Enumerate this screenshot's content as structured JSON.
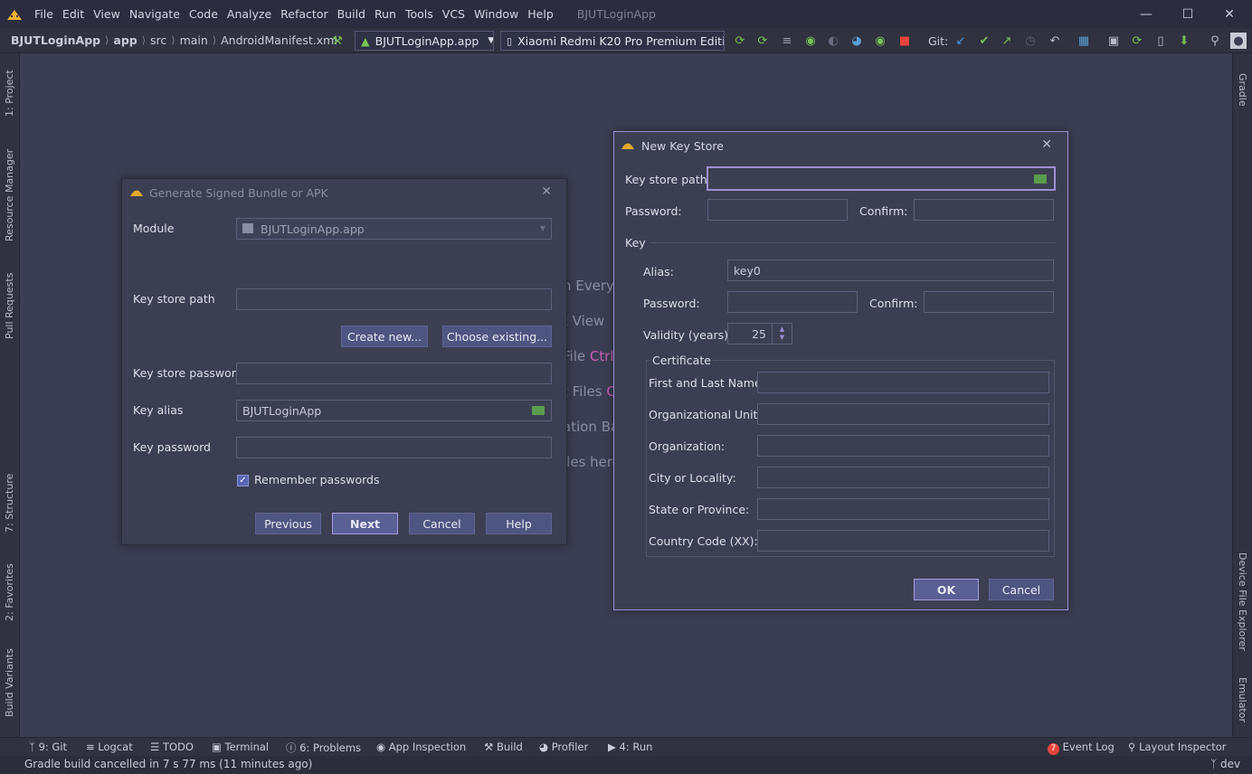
{
  "menubar": {
    "items": [
      "File",
      "Edit",
      "View",
      "Navigate",
      "Code",
      "Analyze",
      "Refactor",
      "Build",
      "Run",
      "Tools",
      "VCS",
      "Window",
      "Help"
    ],
    "app_title": "BJUTLoginApp"
  },
  "navbar": {
    "crumbs": [
      "BJUTLoginApp",
      "app",
      "src",
      "main",
      "AndroidManifest.xml"
    ],
    "run_config": "BJUTLoginApp.app",
    "device": "Xiaomi Redmi K20 Pro Premium Edition",
    "git_label": "Git:"
  },
  "left_tabs": [
    "1: Project",
    "Resource Manager",
    "Pull Requests",
    "7: Structure",
    "2: Favorites",
    "Build Variants"
  ],
  "right_tabs": [
    "Gradle",
    "Device File Explorer",
    "Emulator"
  ],
  "bottom_tabs": [
    "9: Git",
    "Logcat",
    "TODO",
    "Terminal",
    "6: Problems",
    "App Inspection",
    "Build",
    "Profiler",
    "4: Run"
  ],
  "bottom_right": {
    "event_log": "Event Log",
    "event_count": "7",
    "layout_inspector": "Layout Inspector"
  },
  "status": {
    "message": "Gradle build cancelled in 7 s 77 ms (11 minutes ago)",
    "branch": "dev"
  },
  "background_hints": [
    "n Everyw",
    "t View",
    "File",
    "Ctrl",
    "t Files",
    "C",
    "ation Ba",
    "iles here"
  ],
  "signed_dialog": {
    "title": "Generate Signed Bundle or APK",
    "module_label": "Module",
    "module_value": "BJUTLoginApp.app",
    "key_store_path_label": "Key store path",
    "create_new": "Create new...",
    "choose_existing": "Choose existing...",
    "key_store_password_label": "Key store password",
    "key_alias_label": "Key alias",
    "key_alias_value": "BJUTLoginApp",
    "key_password_label": "Key password",
    "remember_label": "Remember passwords",
    "previous": "Previous",
    "next": "Next",
    "cancel": "Cancel",
    "help": "Help"
  },
  "keystore_dialog": {
    "title": "New Key Store",
    "key_store_path_label": "Key store path:",
    "password_label": "Password:",
    "confirm_label": "Confirm:",
    "key_section": "Key",
    "alias_label": "Alias:",
    "alias_value": "key0",
    "key_password_label": "Password:",
    "key_confirm_label": "Confirm:",
    "validity_label": "Validity (years):",
    "validity_value": "25",
    "certificate_label": "Certificate",
    "cert_fields": [
      "First and Last Name:",
      "Organizational Unit:",
      "Organization:",
      "City or Locality:",
      "State or Province:",
      "Country Code (XX):"
    ],
    "ok": "OK",
    "cancel": "Cancel"
  },
  "colors": {
    "accent": "#9d8fd4",
    "folder": "#5b9c4d",
    "android_green": "#78c257",
    "badge_red": "#e8453c"
  }
}
